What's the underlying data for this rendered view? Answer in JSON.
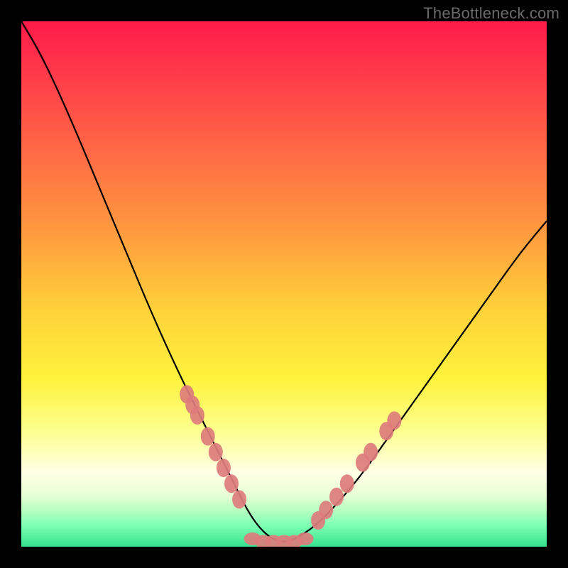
{
  "watermark": "TheBottleneck.com",
  "colors": {
    "frame_border": "#000000",
    "curve": "#000000",
    "marker_fill": "#dd7c7c",
    "gradient_top": "#ff1a49",
    "gradient_mid": "#fff23c",
    "gradient_bottom": "#34e38f"
  },
  "chart_data": {
    "type": "line",
    "title": "",
    "xlabel": "",
    "ylabel": "",
    "xlim": [
      0,
      100
    ],
    "ylim": [
      0,
      100
    ],
    "x": [
      0,
      3,
      6,
      10,
      15,
      20,
      25,
      30,
      34,
      37,
      39,
      41,
      43,
      45,
      47,
      49,
      51,
      53,
      56,
      60,
      65,
      70,
      75,
      80,
      85,
      90,
      95,
      100
    ],
    "y": [
      100,
      95,
      89,
      80,
      68,
      56,
      44,
      33,
      25,
      19,
      15,
      11,
      7,
      4,
      2,
      1,
      1,
      2,
      4,
      8,
      14,
      21,
      28,
      35,
      42,
      49,
      56,
      62
    ],
    "markers": {
      "left_x": [
        31.5,
        32.6,
        33.5,
        35.5,
        37.0,
        38.5,
        40.0,
        41.5
      ],
      "left_y": [
        29.0,
        27.0,
        25.0,
        21.0,
        18.0,
        15.0,
        12.0,
        9.0
      ],
      "bottom_x": [
        44.0,
        46.0,
        48.0,
        50.0,
        52.0,
        54.0
      ],
      "bottom_y": [
        1.5,
        1.0,
        1.0,
        1.0,
        1.0,
        1.5
      ],
      "right_x": [
        56.5,
        58.0,
        60.0,
        62.0,
        65.0,
        66.5,
        69.5,
        71.0
      ],
      "right_y": [
        5.0,
        7.0,
        9.5,
        12.0,
        16.0,
        18.0,
        22.0,
        24.0
      ]
    }
  }
}
